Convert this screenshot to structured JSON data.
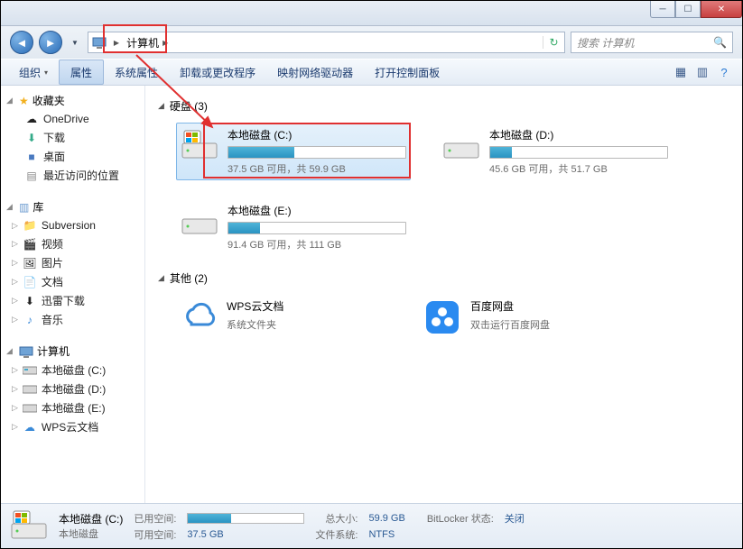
{
  "titlebar": {},
  "navbar": {
    "address_label": "计算机",
    "search_placeholder": "搜索 计算机"
  },
  "toolbar": {
    "organize": "组织",
    "properties": "属性",
    "system_properties": "系统属性",
    "uninstall": "卸载或更改程序",
    "map_drive": "映射网络驱动器",
    "control_panel": "打开控制面板"
  },
  "sidebar": {
    "favorites": {
      "label": "收藏夹",
      "items": [
        {
          "label": "OneDrive",
          "icon": "onedrive"
        },
        {
          "label": "下载",
          "icon": "download"
        },
        {
          "label": "桌面",
          "icon": "desktop"
        },
        {
          "label": "最近访问的位置",
          "icon": "recent"
        }
      ]
    },
    "libraries": {
      "label": "库",
      "items": [
        {
          "label": "Subversion",
          "icon": "folder"
        },
        {
          "label": "视频",
          "icon": "video"
        },
        {
          "label": "图片",
          "icon": "picture"
        },
        {
          "label": "文档",
          "icon": "document"
        },
        {
          "label": "迅雷下载",
          "icon": "download"
        },
        {
          "label": "音乐",
          "icon": "music"
        }
      ]
    },
    "computer": {
      "label": "计算机",
      "items": [
        {
          "label": "本地磁盘 (C:)",
          "icon": "drive-c"
        },
        {
          "label": "本地磁盘 (D:)",
          "icon": "drive"
        },
        {
          "label": "本地磁盘 (E:)",
          "icon": "drive"
        },
        {
          "label": "WPS云文档",
          "icon": "cloud"
        }
      ]
    }
  },
  "main": {
    "hdd_section": "硬盘 (3)",
    "other_section": "其他 (2)",
    "drives": [
      {
        "name": "本地磁盘 (C:)",
        "free": "37.5 GB 可用，共 59.9 GB",
        "fill_pct": 37,
        "selected": true,
        "icon": "drive-win"
      },
      {
        "name": "本地磁盘 (D:)",
        "free": "45.6 GB 可用，共 51.7 GB",
        "fill_pct": 12,
        "selected": false,
        "icon": "drive"
      },
      {
        "name": "本地磁盘 (E:)",
        "free": "91.4 GB 可用，共 111 GB",
        "fill_pct": 18,
        "selected": false,
        "icon": "drive"
      }
    ],
    "others": [
      {
        "name": "WPS云文档",
        "sub": "系统文件夹",
        "icon": "wps"
      },
      {
        "name": "百度网盘",
        "sub": "双击运行百度网盘",
        "icon": "baidu"
      }
    ]
  },
  "status": {
    "drive_name": "本地磁盘 (C:)",
    "drive_sub": "本地磁盘",
    "used_label": "已用空间:",
    "used_pct": 37,
    "free_label": "可用空间:",
    "free_val": "37.5 GB",
    "total_label": "总大小:",
    "total_val": "59.9 GB",
    "fs_label": "文件系统:",
    "fs_val": "NTFS",
    "bitlocker_label": "BitLocker 状态:",
    "bitlocker_val": "关闭"
  }
}
